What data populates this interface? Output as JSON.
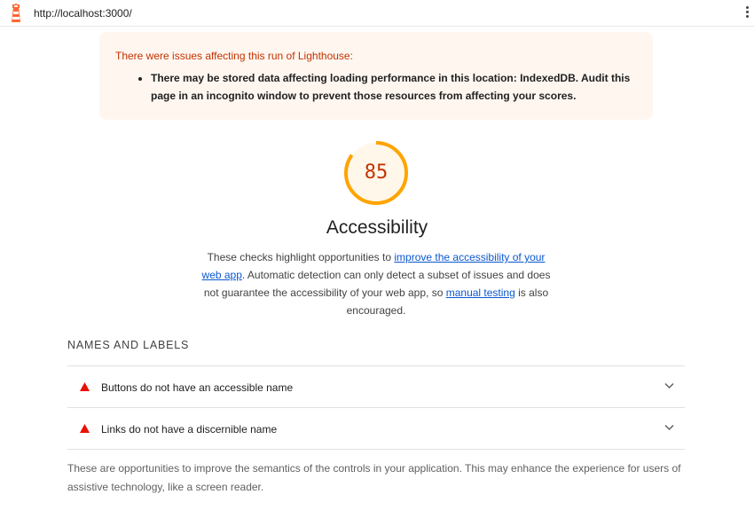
{
  "header": {
    "url": "http://localhost:3000/"
  },
  "warning": {
    "title": "There were issues affecting this run of Lighthouse:",
    "items": [
      "There may be stored data affecting loading performance in this location: IndexedDB. Audit this page in an incognito window to prevent those resources from affecting your scores."
    ]
  },
  "score": {
    "value": "85",
    "fraction": 0.85,
    "color": "#ffa400",
    "text_color": "#c33300"
  },
  "category": {
    "title": "Accessibility",
    "description": {
      "text1": "These checks highlight opportunities to ",
      "link1": "improve the accessibility of your web app",
      "text2": ". Automatic detection can only detect a subset of issues and does not guarantee the accessibility of your web app, so ",
      "link2": "manual testing",
      "text3": " is also encouraged."
    }
  },
  "group": {
    "title": "NAMES AND LABELS",
    "audits": [
      {
        "label": "Buttons do not have an accessible name",
        "icon": "fail-triangle-icon"
      },
      {
        "label": "Links do not have a discernible name",
        "icon": "fail-triangle-icon"
      }
    ],
    "footer": "These are opportunities to improve the semantics of the controls in your application. This may enhance the experience for users of assistive technology, like a screen reader."
  },
  "colors": {
    "fail": "#eb0f00",
    "link": "#0b57d0",
    "warning_bg": "#fff6f0"
  }
}
